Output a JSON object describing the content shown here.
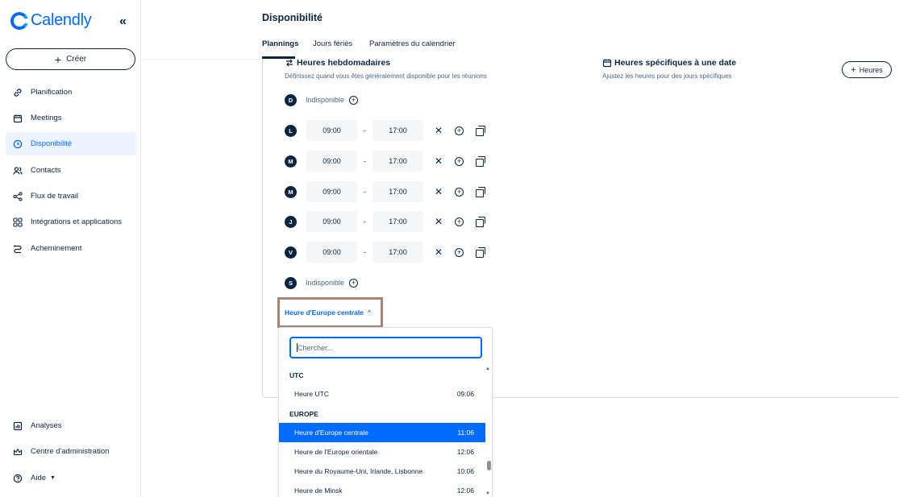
{
  "sidebar": {
    "logo_text": "Calendly",
    "collapse_icon": "«",
    "create_label": "Créer",
    "items": [
      {
        "label": "Planification",
        "icon": "link-icon"
      },
      {
        "label": "Meetings",
        "icon": "calendar-icon"
      },
      {
        "label": "Disponibilité",
        "icon": "clock-icon"
      },
      {
        "label": "Contacts",
        "icon": "contacts-icon"
      },
      {
        "label": "Flux de travail",
        "icon": "workflow-icon"
      },
      {
        "label": "Intégrations et applications",
        "icon": "apps-grid-icon"
      },
      {
        "label": "Acheminement",
        "icon": "routing-icon"
      }
    ],
    "bottom_items": [
      {
        "label": "Analyses",
        "icon": "chart-icon"
      },
      {
        "label": "Centre d'administration",
        "icon": "crown-icon"
      },
      {
        "label": "Aide",
        "icon": "help-icon"
      }
    ]
  },
  "header": {
    "title": "Disponibilité",
    "tabs": [
      {
        "label": "Plannings"
      },
      {
        "label": "Jours fériés"
      },
      {
        "label": "Paramètres du calendrier"
      }
    ]
  },
  "weekly": {
    "title": "Heures hebdomadaires",
    "subtitle": "Définissez quand vous êtes généralement disponible pour les réunions",
    "unavailable_label": "Indisponible",
    "days": [
      {
        "letter": "D",
        "available": false
      },
      {
        "letter": "L",
        "available": true,
        "start": "09:00",
        "end": "17:00"
      },
      {
        "letter": "M",
        "available": true,
        "start": "09:00",
        "end": "17:00"
      },
      {
        "letter": "M",
        "available": true,
        "start": "09:00",
        "end": "17:00"
      },
      {
        "letter": "J",
        "available": true,
        "start": "09:00",
        "end": "17:00"
      },
      {
        "letter": "V",
        "available": true,
        "start": "09:00",
        "end": "17:00"
      },
      {
        "letter": "S",
        "available": false
      }
    ],
    "separator": "-"
  },
  "specific": {
    "title": "Heures spécifiques à une date",
    "subtitle": "Ajustez les heures pour des jours spécifiques",
    "add_button": "Heures"
  },
  "timezone": {
    "selected": "Heure d'Europe centrale",
    "search_placeholder": "Chercher...",
    "groups": [
      {
        "name": "UTC",
        "options": [
          {
            "name": "Heure UTC",
            "time": "09:06"
          }
        ]
      },
      {
        "name": "EUROPE",
        "options": [
          {
            "name": "Heure d'Europe centrale",
            "time": "11:06",
            "selected": true
          },
          {
            "name": "Heure de l'Europe orientale",
            "time": "12:06"
          },
          {
            "name": "Heure du Royaume-Uni, Irlande, Lisbonne",
            "time": "10:06"
          },
          {
            "name": "Heure de Minsk",
            "time": "12:06"
          }
        ]
      }
    ]
  },
  "colors": {
    "accent": "#006bff",
    "navy": "#0a2540",
    "highlight_border": "#a98374"
  }
}
